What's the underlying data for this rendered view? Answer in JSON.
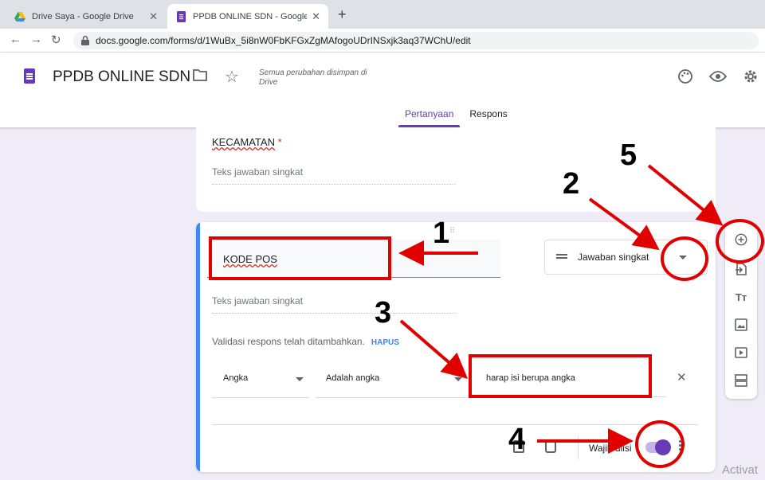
{
  "browser": {
    "tabs": [
      {
        "title": "Drive Saya - Google Drive",
        "active": false
      },
      {
        "title": "PPDB ONLINE SDN - Google For...",
        "active": true
      }
    ],
    "close_glyph": "✕",
    "newtab_glyph": "+",
    "url": "docs.google.com/forms/d/1WuBx_5i8nW0FbKFGxZgMAfogoUDrINSxjk3aq37WChU/edit"
  },
  "header": {
    "title": "PPDB ONLINE SDN",
    "save_note": "Semua perubahan disimpan di Drive",
    "tabs": [
      "Pertanyaan",
      "Respons"
    ],
    "accent": "#673ab7"
  },
  "card1": {
    "question": "KECAMATAN",
    "required_mark": "*",
    "answer_placeholder": "Teks jawaban singkat"
  },
  "card2": {
    "question": "KODE POS",
    "answer_placeholder": "Teks jawaban singkat",
    "type_label": "Jawaban singkat",
    "validation_note": "Validasi respons telah ditambahkan.",
    "hapus": "HAPUS",
    "validation_type": "Angka",
    "validation_rule": "Adalah angka",
    "error_text": "harap isi berupa angka",
    "clear_glyph": "✕",
    "required_label": "Wajib diisi",
    "required_on": true,
    "drag_handle": "⠿"
  },
  "side_toolbar": [
    "add-question-icon",
    "import-questions-icon",
    "add-title-icon",
    "add-image-icon",
    "add-video-icon",
    "add-section-icon"
  ],
  "watermark": "Activat",
  "annotations": [
    "1",
    "2",
    "3",
    "4",
    "5"
  ],
  "annotation_color": "#e00000"
}
